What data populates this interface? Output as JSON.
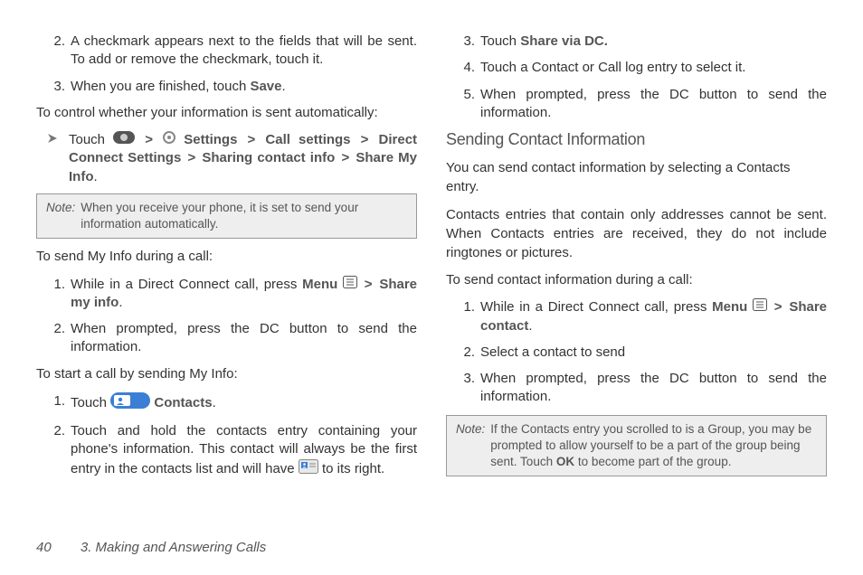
{
  "left": {
    "item2": "A checkmark appears next to the fields that will be sent. To add or remove the checkmark, touch it.",
    "item3_pre": "When you are finished, touch ",
    "item3_bold": "Save",
    "intro_auto": "To control whether your information is sent automatically:",
    "bullet_pre": "Touch ",
    "b_settings": "Settings",
    "b_callset": "Call settings",
    "b_dcs": "Direct Connect Settings",
    "b_sharinfo": "Sharing contact info",
    "b_sharemy": "Share My Info",
    "note1": "When you receive your phone, it is set to send your information automatically.",
    "intro_send": "To send My Info during a call:",
    "s1_pre": "While in a Direct Connect call, press ",
    "s1_menu": "Menu",
    "s1_share": "Share my info",
    "s2": "When prompted, press the DC button to send the information.",
    "intro_start": "To start a call by sending My Info:",
    "t1_pre": "Touch ",
    "t1_contacts": "Contacts",
    "t2": "Touch and hold the contacts entry containing your phone's information. This contact will always be the first entry in the contacts list and will have ",
    "t2_suffix": " to its right."
  },
  "right": {
    "r3_pre": "Touch ",
    "r3_bold": "Share via DC.",
    "r4": "Touch a Contact or Call log entry to select it.",
    "r5": "When prompted, press the DC button to send the information.",
    "h2": "Sending Contact Information",
    "p1": "You can send contact information by selecting a Contacts entry.",
    "p2": "Contacts entries that contain only addresses cannot be sent. When Contacts entries are received, they do not include ringtones or pictures.",
    "intro": "To send contact information during a call:",
    "c1_pre": "While in a Direct Connect call, press ",
    "c1_menu": "Menu",
    "c1_share": "Share contact",
    "c2": "Select a contact to send",
    "c3": "When prompted, press the DC button to send the information.",
    "note2_a": "If the Contacts entry you scrolled to is a Group, you may be prompted to allow yourself to be a part of the group being sent. Touch ",
    "note2_ok": "OK",
    "note2_b": " to become part of the group."
  },
  "labels": {
    "note": "Note:",
    "gt": ">",
    "dot": "."
  },
  "nums": {
    "n1": "1.",
    "n2": "2.",
    "n3": "3.",
    "n4": "4.",
    "n5": "5."
  },
  "footer": {
    "page": "40",
    "chapter": "3. Making and Answering Calls"
  }
}
